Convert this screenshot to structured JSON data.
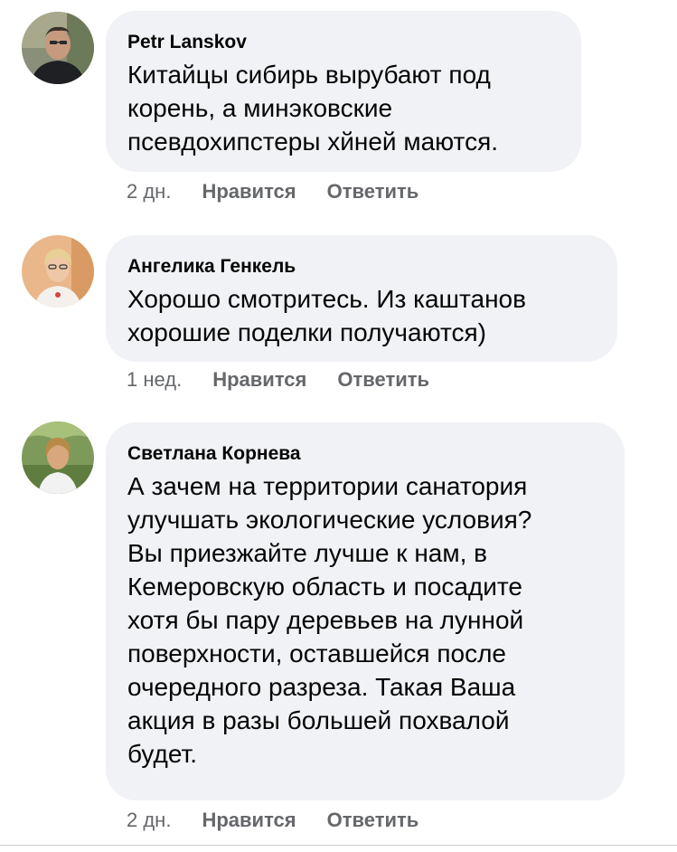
{
  "comments": [
    {
      "author": "Petr Lanskov",
      "text": "Китайцы сибирь вырубают под\nкорень, а минэковские\nпсевдохипстеры хйней маются.",
      "time": "2 дн.",
      "like_label": "Нравится",
      "reply_label": "Ответить",
      "avatar_icon": "avatar-man-icon"
    },
    {
      "author": "Ангелика Генкель",
      "text": "Хорошо смотритесь. Из каштанов\nхорошие поделки получаются)",
      "time": "1 нед.",
      "like_label": "Нравится",
      "reply_label": "Ответить",
      "avatar_icon": "avatar-woman-icon"
    },
    {
      "author": "Светлана Корнева",
      "text": "А зачем на территории санатория\nулучшать экологические условия?\nВы приезжайте лучше к нам, в\nКемеровскую область и посадите\nхотя бы пару деревьев на лунной\nповерхности, оставшейся после\nочередного разреза. Такая Ваша\nакция в разы большей похвалой\nбудет.",
      "time": "2 дн.",
      "like_label": "Нравится",
      "reply_label": "Ответить",
      "avatar_icon": "avatar-woman-icon"
    }
  ],
  "colors": {
    "bubble": "#f0f2f5",
    "text": "#050505",
    "meta": "#65676b"
  }
}
